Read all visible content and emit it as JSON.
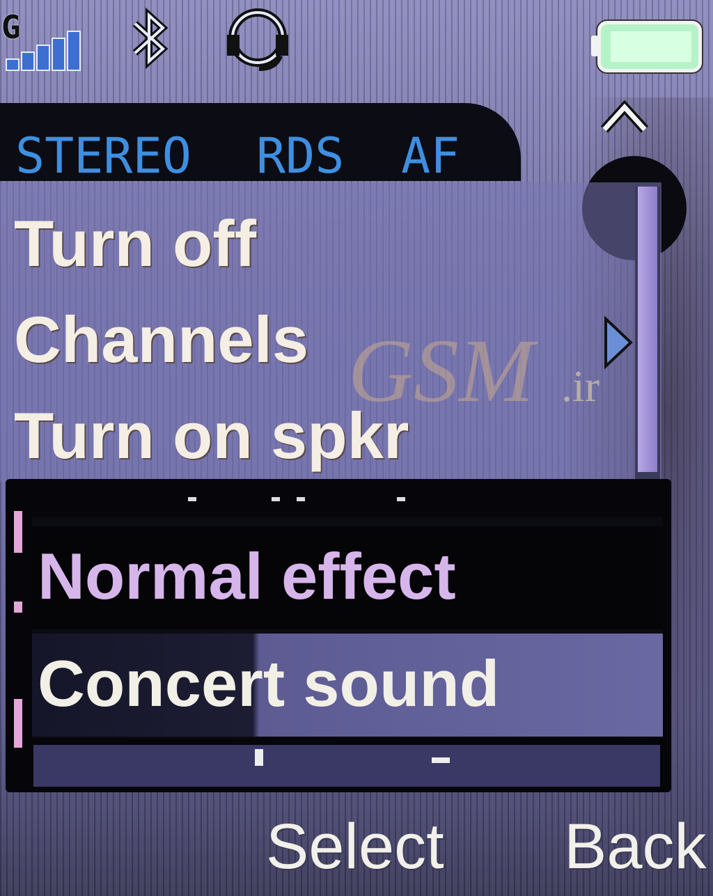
{
  "status_bar": {
    "network_letter": "G",
    "signal_icon": "signal-strength-icon",
    "bluetooth_icon": "bluetooth-icon",
    "headset_icon": "headset-icon",
    "battery_icon": "battery-full-icon"
  },
  "radio_indicators": [
    "STEREO",
    "RDS",
    "AF"
  ],
  "menu": {
    "items": [
      {
        "label": "Turn off"
      },
      {
        "label": "Channels",
        "has_submenu": true
      },
      {
        "label": "Turn on spkr"
      }
    ]
  },
  "watermark": {
    "text": "GSM",
    "suffix": ".ir"
  },
  "popup": {
    "options": [
      {
        "label": "Normal effect",
        "selected": true
      },
      {
        "label": "Concert sound",
        "selected": false
      }
    ]
  },
  "softkeys": {
    "left": "Select",
    "right": "Back"
  },
  "colors": {
    "indicator_text": "#3e8fe0",
    "selected_text": "#d6b6ea",
    "menu_text": "#f4eee4",
    "panel_black": "#06060a"
  }
}
